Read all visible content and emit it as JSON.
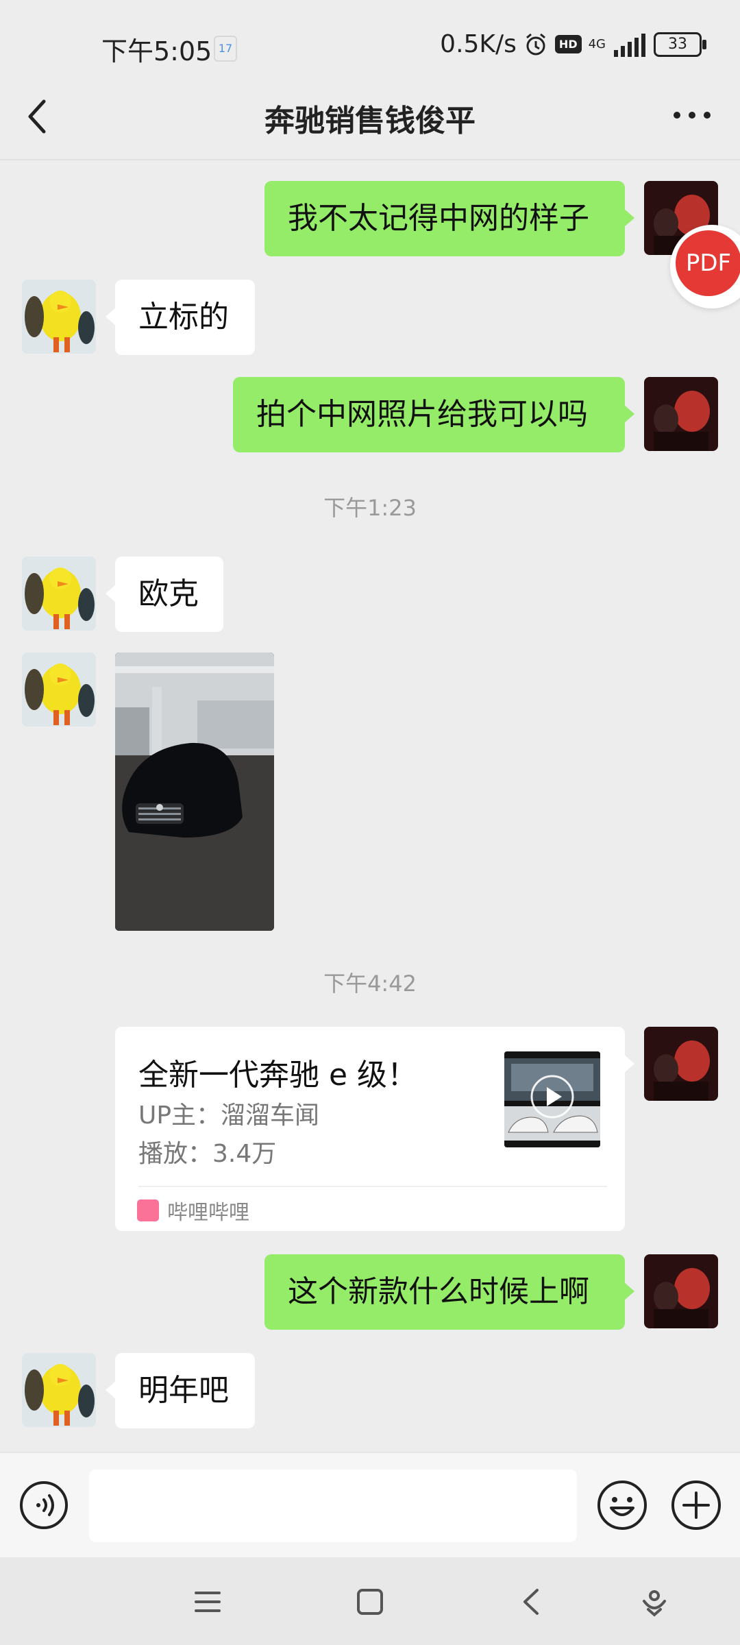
{
  "status_bar": {
    "time": "下午5:05",
    "calendar_day": "17",
    "speed": "0.5K/s",
    "hd": "HD",
    "network": "4G",
    "battery": "33"
  },
  "header": {
    "title": "奔驰销售钱俊平"
  },
  "pdf_button": {
    "label": "PDF"
  },
  "messages": [
    {
      "side": "right",
      "text": "我不太记得中网的样子"
    },
    {
      "side": "left",
      "text": "立标的"
    },
    {
      "side": "right",
      "text": "拍个中网照片给我可以吗"
    },
    {
      "time": "下午1:23"
    },
    {
      "side": "left",
      "text": "欧克"
    },
    {
      "side": "left",
      "type": "image"
    },
    {
      "time": "下午4:42"
    },
    {
      "side": "right",
      "type": "card"
    },
    {
      "side": "right",
      "text": "这个新款什么时候上啊"
    },
    {
      "side": "left",
      "text": "明年吧"
    }
  ],
  "card": {
    "title": "全新一代奔驰 e 级！",
    "up": "UP主：溜溜车闻",
    "plays": "播放：3.4万",
    "source": "哔哩哔哩"
  },
  "colors": {
    "background": "#ededed",
    "sent_bubble": "#95ec69",
    "received_bubble": "#ffffff",
    "pdf_red": "#e53935"
  }
}
